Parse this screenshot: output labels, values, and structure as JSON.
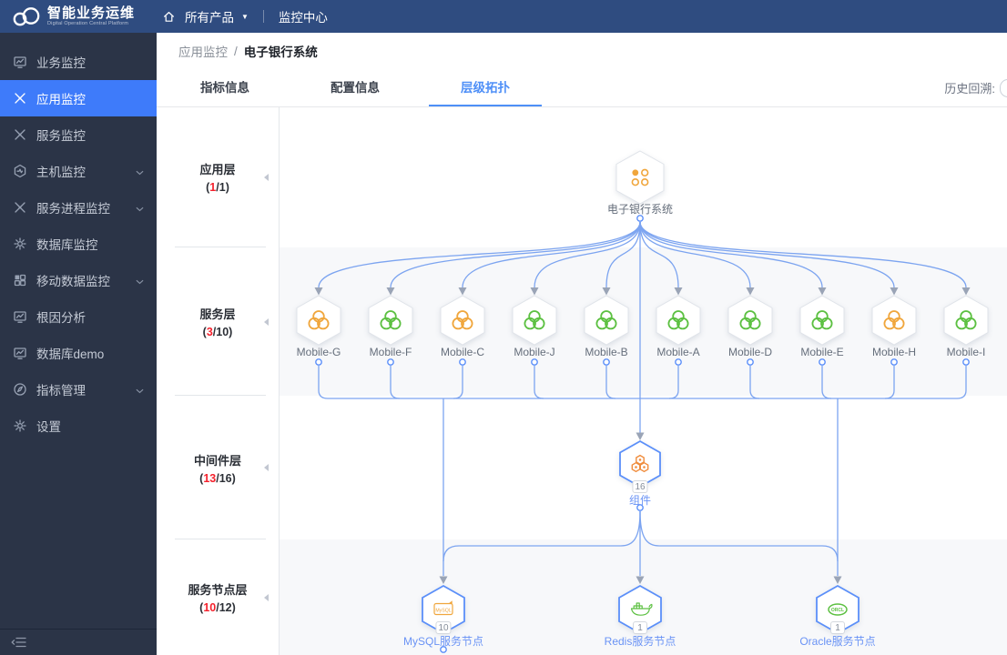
{
  "navbar": {
    "logo_title": "智能业务运维",
    "logo_subtitle": "Digital Operation Central Platform",
    "products_label": "所有产品",
    "center_label": "监控中心"
  },
  "sidebar": {
    "items": [
      {
        "label": "业务监控",
        "icon": "chart-monitor-icon",
        "active": false,
        "expandable": false
      },
      {
        "label": "应用监控",
        "icon": "app-monitor-icon",
        "active": true,
        "expandable": false
      },
      {
        "label": "服务监控",
        "icon": "service-monitor-icon",
        "active": false,
        "expandable": false
      },
      {
        "label": "主机监控",
        "icon": "host-monitor-icon",
        "active": false,
        "expandable": true
      },
      {
        "label": "服务进程监控",
        "icon": "process-monitor-icon",
        "active": false,
        "expandable": true
      },
      {
        "label": "数据库监控",
        "icon": "database-monitor-icon",
        "active": false,
        "expandable": false
      },
      {
        "label": "移动数据监控",
        "icon": "mobile-data-icon",
        "active": false,
        "expandable": true
      },
      {
        "label": "根因分析",
        "icon": "root-cause-icon",
        "active": false,
        "expandable": false
      },
      {
        "label": "数据库demo",
        "icon": "database-demo-icon",
        "active": false,
        "expandable": false
      },
      {
        "label": "指标管理",
        "icon": "metric-manage-icon",
        "active": false,
        "expandable": true
      },
      {
        "label": "设置",
        "icon": "settings-icon",
        "active": false,
        "expandable": false
      }
    ]
  },
  "breadcrumb": {
    "section": "应用监控",
    "separator": "/",
    "current": "电子银行系统"
  },
  "tabs": [
    {
      "label": "指标信息",
      "active": false
    },
    {
      "label": "配置信息",
      "active": false
    },
    {
      "label": "层级拓扑",
      "active": true
    }
  ],
  "history_label": "历史回溯:",
  "layers": [
    {
      "name": "应用层",
      "alert_count": "1",
      "total_count": "1"
    },
    {
      "name": "服务层",
      "alert_count": "3",
      "total_count": "10"
    },
    {
      "name": "中间件层",
      "alert_count": "13",
      "total_count": "16"
    },
    {
      "name": "服务节点层",
      "alert_count": "10",
      "total_count": "12"
    }
  ],
  "topology": {
    "root": {
      "label": "电子银行系统",
      "status": "warning",
      "icon": "app-system-icon"
    },
    "services": [
      {
        "label": "Mobile-G",
        "status": "warning",
        "icon": "cluster-icon"
      },
      {
        "label": "Mobile-F",
        "status": "ok",
        "icon": "cluster-icon"
      },
      {
        "label": "Mobile-C",
        "status": "warning",
        "icon": "cluster-icon"
      },
      {
        "label": "Mobile-J",
        "status": "ok",
        "icon": "cluster-icon"
      },
      {
        "label": "Mobile-B",
        "status": "ok",
        "icon": "cluster-icon"
      },
      {
        "label": "Mobile-A",
        "status": "ok",
        "icon": "cluster-icon"
      },
      {
        "label": "Mobile-D",
        "status": "ok",
        "icon": "cluster-icon"
      },
      {
        "label": "Mobile-E",
        "status": "ok",
        "icon": "cluster-icon"
      },
      {
        "label": "Mobile-H",
        "status": "warning",
        "icon": "cluster-icon"
      },
      {
        "label": "Mobile-I",
        "status": "ok",
        "icon": "cluster-icon"
      }
    ],
    "middleware": {
      "label": "组件",
      "badge": "16",
      "icon": "component-icon"
    },
    "service_nodes": [
      {
        "label": "MySQL服务节点",
        "badge": "10",
        "icon": "mysql-icon"
      },
      {
        "label": "Redis服务节点",
        "badge": "1",
        "icon": "redis-icon"
      },
      {
        "label": "Oracle服务节点",
        "badge": "1",
        "icon": "oracle-icon"
      }
    ]
  },
  "colors": {
    "warning": "#F0A63C",
    "ok": "#5CC041",
    "accent_blue": "#3E7BFA",
    "link_blue": "#5B8FF9",
    "edge_line": "#7CA4F0",
    "arrow": "#9AA4B6",
    "alert_red": "#F5222D",
    "navbar_bg": "#2F4C80",
    "sidebar_bg": "#2B3447"
  }
}
